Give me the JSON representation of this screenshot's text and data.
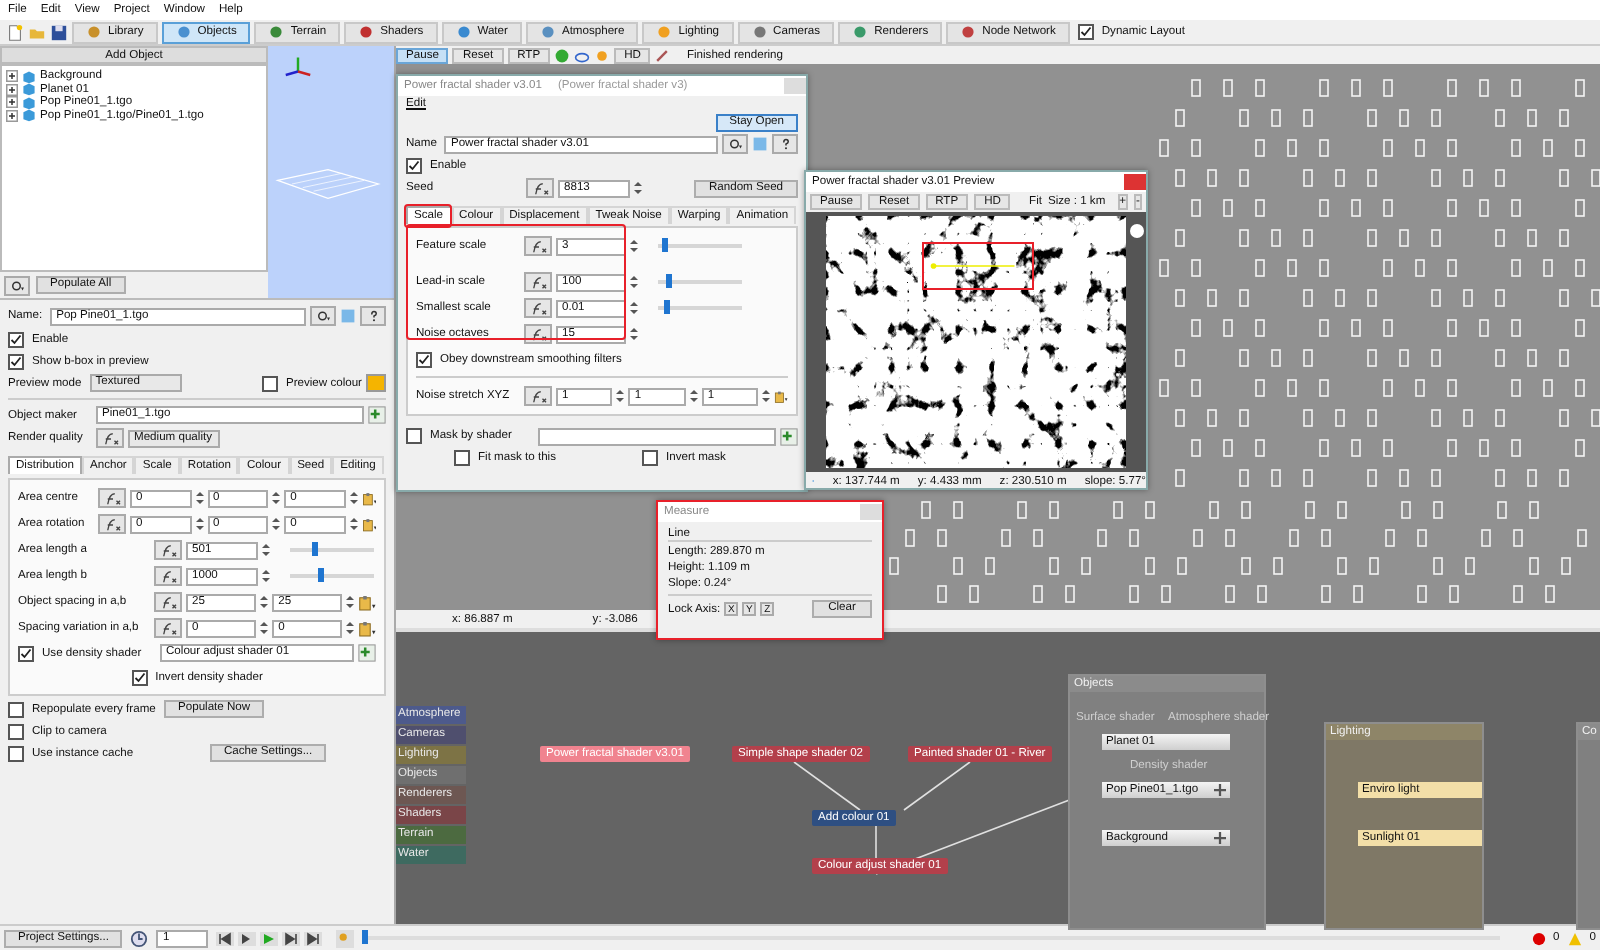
{
  "menu": [
    "File",
    "Edit",
    "View",
    "Project",
    "Window",
    "Help"
  ],
  "toolbar": {
    "tabs": [
      {
        "label": "Library",
        "selected": false
      },
      {
        "label": "Objects",
        "selected": true
      },
      {
        "label": "Terrain",
        "selected": false
      },
      {
        "label": "Shaders",
        "selected": false
      },
      {
        "label": "Water",
        "selected": false
      },
      {
        "label": "Atmosphere",
        "selected": false
      },
      {
        "label": "Lighting",
        "selected": false
      },
      {
        "label": "Cameras",
        "selected": false
      },
      {
        "label": "Renderers",
        "selected": false
      },
      {
        "label": "Node Network",
        "selected": false
      }
    ],
    "dynamic_layout": {
      "label": "Dynamic Layout",
      "checked": true
    }
  },
  "object_list": {
    "add_button": "Add Object",
    "items": [
      {
        "label": "Background"
      },
      {
        "label": "Planet 01"
      },
      {
        "label": "Pop Pine01_1.tgo"
      },
      {
        "label": "Pop Pine01_1.tgo/Pine01_1.tgo"
      }
    ],
    "populate_button": "Populate All"
  },
  "object_props": {
    "name_label": "Name:",
    "name": "Pop Pine01_1.tgo",
    "enable": {
      "label": "Enable",
      "checked": true
    },
    "show_bbox": {
      "label": "Show b-box in preview",
      "checked": true
    },
    "preview_mode": {
      "label": "Preview mode",
      "value": "Textured"
    },
    "preview_colour": {
      "label": "Preview colour",
      "checked": false
    },
    "object_maker": {
      "label": "Object maker",
      "value": "Pine01_1.tgo"
    },
    "render_quality": {
      "label": "Render quality",
      "value": "Medium quality"
    },
    "tabs": [
      {
        "label": "Distribution",
        "selected": true
      },
      {
        "label": "Anchor",
        "selected": false
      },
      {
        "label": "Scale",
        "selected": false
      },
      {
        "label": "Rotation",
        "selected": false
      },
      {
        "label": "Colour",
        "selected": false
      },
      {
        "label": "Seed",
        "selected": false
      },
      {
        "label": "Editing",
        "selected": false
      }
    ],
    "rows": [
      {
        "kind": "triple",
        "label": "Area centre",
        "values": [
          "0",
          "0",
          "0"
        ]
      },
      {
        "kind": "triple",
        "label": "Area rotation",
        "values": [
          "0",
          "0",
          "0"
        ]
      },
      {
        "kind": "slider",
        "label": "Area length a",
        "values": [
          "501"
        ],
        "level": 0.25
      },
      {
        "kind": "slider",
        "label": "Area length b",
        "values": [
          "1000"
        ],
        "level": 0.33
      },
      {
        "kind": "pair",
        "label": "Object spacing in a,b",
        "values": [
          "25",
          "25"
        ]
      },
      {
        "kind": "pair",
        "label": "Spacing variation in a,b",
        "values": [
          "0",
          "0"
        ]
      }
    ],
    "density": {
      "label": "Use density shader",
      "checked": true,
      "value": "Colour adjust shader 01"
    },
    "invert_density": {
      "label": "Invert density shader",
      "checked": true
    },
    "repopulate": {
      "label": "Repopulate every frame",
      "checked": false
    },
    "populate_now": "Populate Now",
    "clip": {
      "label": "Clip to camera",
      "checked": false
    },
    "instance_cache": {
      "label": "Use instance cache",
      "checked": false
    },
    "cache_settings": "Cache Settings..."
  },
  "viewport": {
    "buttons": [
      {
        "label": "Pause",
        "selected": true
      },
      {
        "label": "Reset",
        "selected": false
      },
      {
        "label": "RTP",
        "selected": false
      }
    ],
    "hd": "HD",
    "status": "Finished rendering",
    "coords": [
      "x: 86.887 m",
      "y: -3.086"
    ]
  },
  "shader_dialog": {
    "title": "Power fractal shader v3.01",
    "subtitle": "(Power fractal shader v3)",
    "menu": "Edit",
    "stay_open": "Stay Open",
    "name_label": "Name",
    "name": "Power fractal shader v3.01",
    "enable": {
      "label": "Enable",
      "checked": true
    },
    "seed_label": "Seed",
    "seed": "8813",
    "random_seed": "Random Seed",
    "tabs": [
      {
        "label": "Scale",
        "selected": true
      },
      {
        "label": "Colour",
        "selected": false
      },
      {
        "label": "Displacement",
        "selected": false
      },
      {
        "label": "Tweak Noise",
        "selected": false
      },
      {
        "label": "Warping",
        "selected": false
      },
      {
        "label": "Animation",
        "selected": false
      }
    ],
    "params": [
      {
        "kind": "slider",
        "label": "Feature scale",
        "value": "3",
        "level": 0.05
      },
      {
        "kind": "slider",
        "label": "Lead-in scale",
        "value": "100",
        "level": 0.1
      },
      {
        "kind": "slider",
        "label": "Smallest scale",
        "value": "0.01",
        "level": 0.06
      },
      {
        "kind": "plain",
        "label": "Noise octaves",
        "value": "15"
      }
    ],
    "obey": {
      "label": "Obey downstream smoothing filters",
      "checked": true
    },
    "stretch": {
      "label": "Noise stretch XYZ",
      "values": [
        "1",
        "1",
        "1"
      ]
    },
    "mask": {
      "label": "Mask by shader",
      "checked": false
    },
    "fit_mask": {
      "label": "Fit mask to this",
      "checked": false
    },
    "invert_mask": {
      "label": "Invert mask",
      "checked": false
    }
  },
  "preview": {
    "title": "Power fractal shader v3.01 Preview",
    "buttons": [
      "Pause",
      "Reset",
      "RTP",
      "HD"
    ],
    "fit": "Fit",
    "size": "Size : 1 km",
    "zoom_buttons": [
      "+",
      "-"
    ],
    "readouts": [
      "x: 137.744 m",
      "y: 4.433 mm",
      "z: 230.510 m",
      "slope: 5.77°"
    ]
  },
  "measure": {
    "title": "Measure",
    "mode": "Line",
    "lines": [
      "Length: 289.870 m",
      "Height: 1.109 m",
      "Slope: 0.24°"
    ],
    "lock_label": "Lock Axis:",
    "axes": [
      {
        "label": "X",
        "selected": false
      },
      {
        "label": "Y",
        "selected": false
      },
      {
        "label": "Z",
        "selected": false
      }
    ],
    "clear": "Clear"
  },
  "node_network": {
    "palette": [
      {
        "label": "Atmosphere",
        "color": "#4d5a8c"
      },
      {
        "label": "Cameras",
        "color": "#4f4f6e"
      },
      {
        "label": "Lighting",
        "color": "#7d7345"
      },
      {
        "label": "Objects",
        "color": "#6f6f6f"
      },
      {
        "label": "Renderers",
        "color": "#6d5752"
      },
      {
        "label": "Shaders",
        "color": "#7a4548"
      },
      {
        "label": "Terrain",
        "color": "#4c6a40"
      },
      {
        "label": "Water",
        "color": "#3e6a60"
      }
    ],
    "nodes": [
      {
        "label": "Power fractal shader v3.01",
        "kind": "shader",
        "selected": true
      },
      {
        "label": "Simple shape shader 02",
        "kind": "shader",
        "selected": false
      },
      {
        "label": "Painted shader 01 - River",
        "kind": "shader",
        "selected": false
      },
      {
        "label": "Add colour 01",
        "kind": "colour",
        "selected": false
      },
      {
        "label": "Colour adjust shader 01",
        "kind": "shader",
        "selected": false
      }
    ],
    "objects_group": {
      "title": "Objects",
      "port_labels": [
        "Surface shader",
        "Atmosphere shader",
        "Density shader"
      ],
      "nodes": [
        {
          "label": "Planet 01",
          "expandable": false
        },
        {
          "label": "Pop Pine01_1.tgo",
          "expandable": true
        },
        {
          "label": "Background",
          "expandable": true
        }
      ]
    },
    "lighting_group": {
      "title": "Lighting",
      "nodes": [
        "Enviro light",
        "Sunlight 01"
      ]
    },
    "cut_group": {
      "title": "Co"
    }
  },
  "bottom_bar": {
    "project_settings": "Project Settings...",
    "frame": "1",
    "timeline": {
      "level": 0
    },
    "errors": "0",
    "warnings": "0"
  }
}
